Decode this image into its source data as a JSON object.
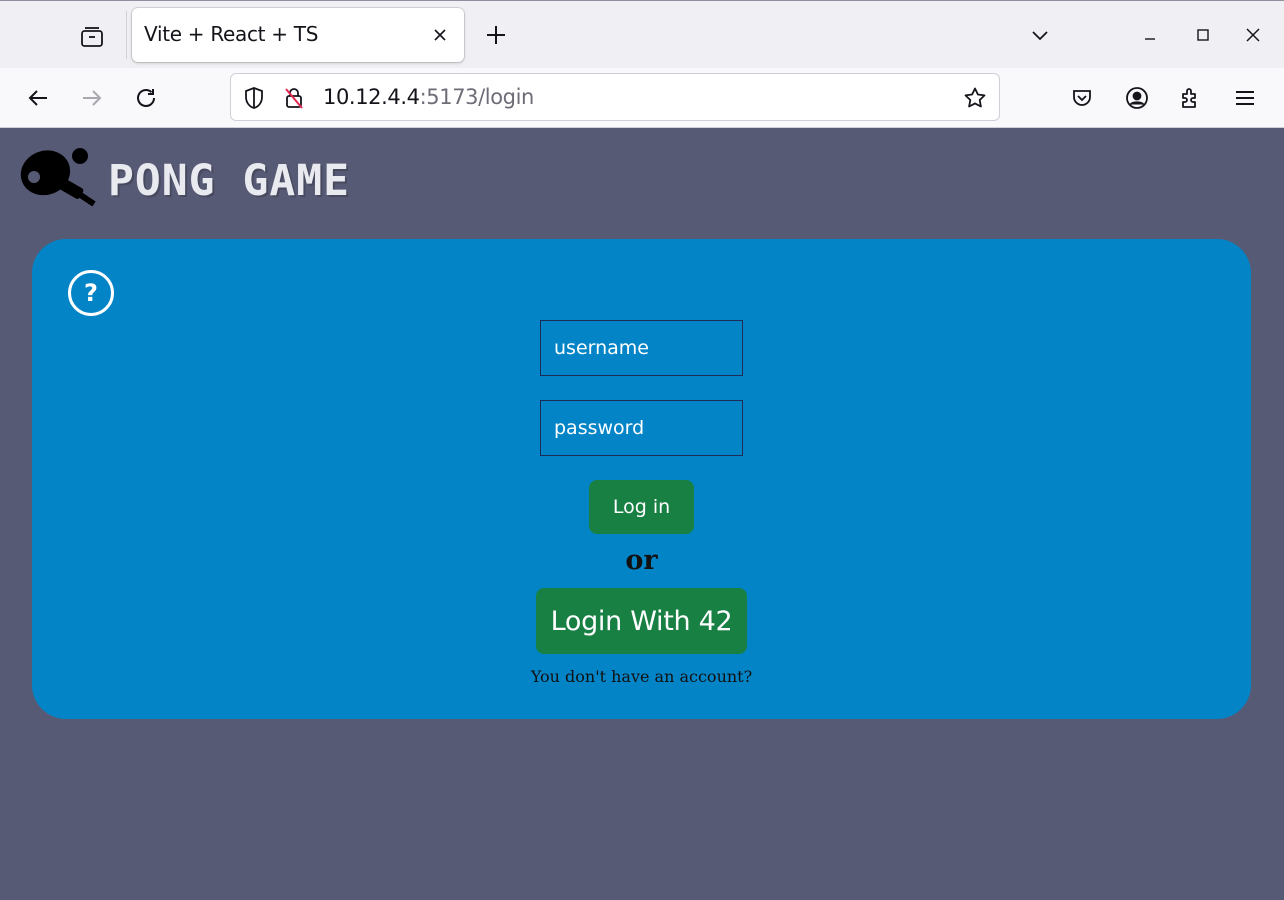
{
  "browser": {
    "tab_title": "Vite + React + TS",
    "url_host": "10.12.4.4",
    "url_path": ":5173/login"
  },
  "app": {
    "brand": "PONG GAME"
  },
  "login": {
    "help_icon": "?",
    "username_placeholder": "username",
    "password_placeholder": "password",
    "login_label": "Log in",
    "or_label": "or",
    "login42_label": "Login With 42",
    "signup_text": "You don't have an account?"
  },
  "colors": {
    "page_bg": "#575a74",
    "card_bg": "#0384c7",
    "button_green": "#198044"
  }
}
